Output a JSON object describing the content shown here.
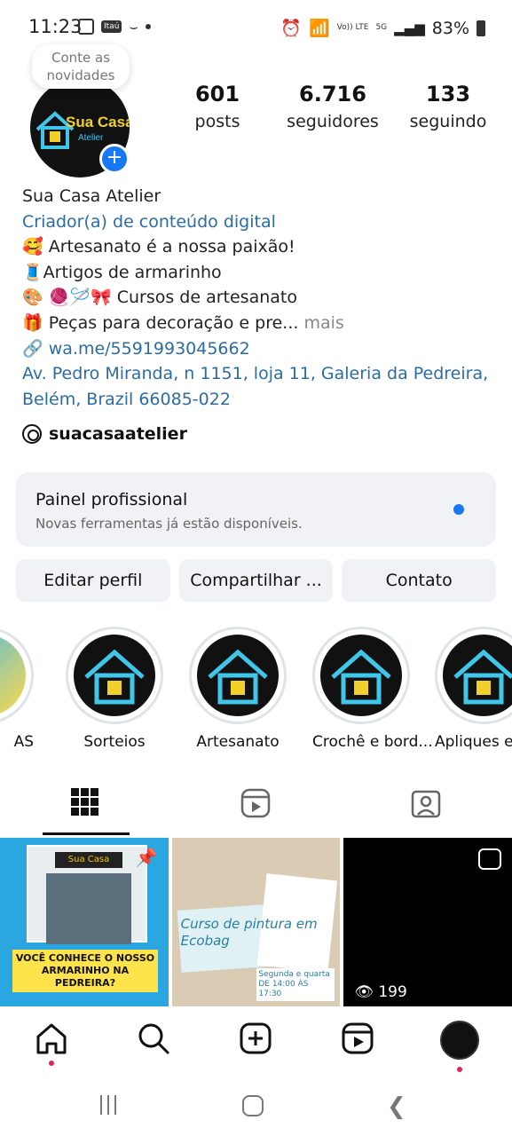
{
  "status_bar": {
    "time": "11:23",
    "bank_label": "Itaú",
    "volte": "Vo)) LTE",
    "network": "5G",
    "battery": "83%"
  },
  "profile": {
    "note": "Conte as novidades",
    "avatar_text": "Sua Casa",
    "avatar_subtext": "Atelier",
    "stats": [
      {
        "value": "601",
        "label": "posts"
      },
      {
        "value": "6.716",
        "label": "seguidores"
      },
      {
        "value": "133",
        "label": "seguindo"
      }
    ],
    "name": "Sua Casa Atelier",
    "category": "Criador(a) de conteúdo digital",
    "bio_lines": [
      "🥰 Artesanato é a nossa paixão!",
      "🧵Artigos de armarinho",
      "🎨 🧶🪡🎀 Cursos de artesanato"
    ],
    "bio_last": "🎁 Peças para decoração e pre...",
    "bio_more": "mais",
    "link": "wa.me/5591993045662",
    "address": "Av. Pedro Miranda, n 1151, loja 11, Galeria da Pedreira, Belém, Brazil 66085-022",
    "threads_handle": "suacasaatelier"
  },
  "panel": {
    "title": "Painel profissional",
    "subtitle": "Novas ferramentas já estão disponíveis."
  },
  "buttons": {
    "edit": "Editar perfil",
    "share": "Compartilhar ...",
    "contact": "Contato"
  },
  "highlights": [
    {
      "label": "AS"
    },
    {
      "label": "Sorteios"
    },
    {
      "label": "Artesanato"
    },
    {
      "label": "Crochê e bord..."
    },
    {
      "label": "Apliques e f"
    }
  ],
  "posts": [
    {
      "caption": "VOCÊ CONHECE O NOSSO ARMARINHO NA PEDREIRA?",
      "store_sign": "Sua Casa"
    },
    {
      "caption": "Curso de pintura em Ecobag",
      "footer": "Segunda e quarta DE 14:00 ÀS 17:30"
    },
    {
      "views": "199"
    }
  ],
  "icons": {
    "grid": "grid-icon",
    "reels": "reels-icon",
    "tagged": "tagged-icon",
    "home": "home-icon",
    "search": "search-icon",
    "add": "add-icon",
    "profile": "profile-avatar"
  },
  "colors": {
    "link_blue": "#2b6ca3",
    "accent": "#1877f2",
    "notification": "#e0245e"
  }
}
